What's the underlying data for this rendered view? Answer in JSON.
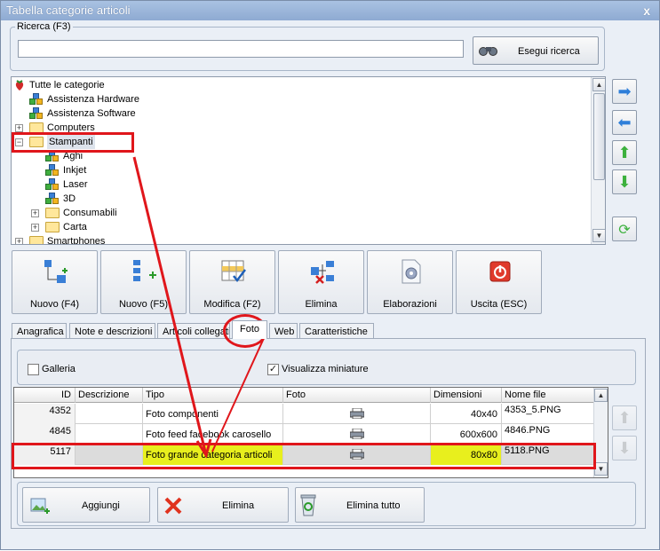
{
  "window": {
    "title": "Tabella categorie articoli",
    "close_glyph": "x"
  },
  "search": {
    "group_label": "Ricerca (F3)",
    "value": "",
    "button_label": "Esegui ricerca"
  },
  "tree": {
    "items": [
      {
        "label": "Tutte le categorie",
        "icon": "strawberry-icon"
      },
      {
        "label": "Assistenza Hardware",
        "icon": "cubes-icon"
      },
      {
        "label": "Assistenza Software",
        "icon": "cubes-icon"
      },
      {
        "label": "Computers",
        "icon": "folder-icon",
        "expander": "+"
      },
      {
        "label": "Stampanti",
        "icon": "folder-icon",
        "expander": "−"
      },
      {
        "label": "Aghi",
        "icon": "cubes-icon"
      },
      {
        "label": "Inkjet",
        "icon": "cubes-icon"
      },
      {
        "label": "Laser",
        "icon": "cubes-icon"
      },
      {
        "label": "3D",
        "icon": "cubes-icon"
      },
      {
        "label": "Consumabili",
        "icon": "folder-icon",
        "expander": "+"
      },
      {
        "label": "Carta",
        "icon": "folder-icon",
        "expander": "+"
      },
      {
        "label": "Smartphones",
        "icon": "folder-icon",
        "expander": "+"
      }
    ]
  },
  "toolbar": {
    "buttons": [
      {
        "label": "Nuovo (F4)"
      },
      {
        "label": "Nuovo (F5)"
      },
      {
        "label": "Modifica (F2)"
      },
      {
        "label": "Elimina"
      },
      {
        "label": "Elaborazioni"
      },
      {
        "label": "Uscita (ESC)"
      }
    ]
  },
  "tabs": [
    {
      "label": "Anagrafica"
    },
    {
      "label": "Note e descrizioni"
    },
    {
      "label": "Articoli collegati"
    },
    {
      "label": "Foto",
      "active": true
    },
    {
      "label": "Web"
    },
    {
      "label": "Caratteristiche"
    }
  ],
  "options": {
    "gallery_label": "Galleria",
    "gallery_checked": false,
    "thumbnails_label": "Visualizza miniature",
    "thumbnails_checked": true
  },
  "grid": {
    "columns": [
      "ID",
      "Descrizione",
      "Tipo",
      "Foto",
      "Dimensioni",
      "Nome file"
    ],
    "rows": [
      {
        "id": "4352",
        "descrizione": "",
        "tipo": "Foto componenti",
        "dimensioni": "40x40",
        "nome_file": "4353_5.PNG"
      },
      {
        "id": "4845",
        "descrizione": "",
        "tipo": "Foto feed facebook carosello",
        "dimensioni": "600x600",
        "nome_file": "4846.PNG"
      },
      {
        "id": "5117",
        "descrizione": "",
        "tipo": "Foto grande categoria articoli",
        "dimensioni": "80x80",
        "nome_file": "5118.PNG"
      }
    ]
  },
  "bottom_buttons": [
    {
      "label": "Aggiungi"
    },
    {
      "label": "Elimina"
    },
    {
      "label": "Elimina tutto"
    }
  ],
  "colors": {
    "highlight": "#e8ef1d",
    "annotation_red": "#e0161b",
    "title_bar": "#9bb6da"
  }
}
